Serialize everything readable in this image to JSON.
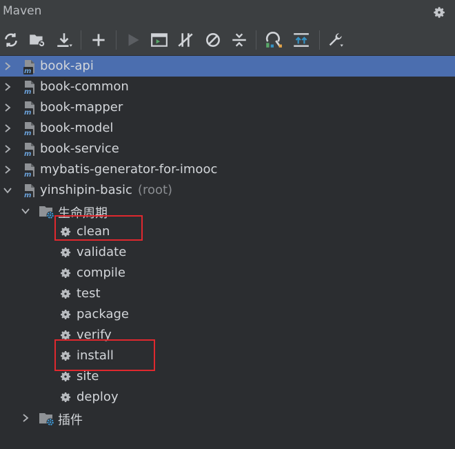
{
  "panel": {
    "title": "Maven"
  },
  "tree": {
    "projects": [
      {
        "label": "book-api"
      },
      {
        "label": "book-common"
      },
      {
        "label": "book-mapper"
      },
      {
        "label": "book-model"
      },
      {
        "label": "book-service"
      },
      {
        "label": "mybatis-generator-for-imooc"
      },
      {
        "label": "yinshipin-basic",
        "suffix": "(root)"
      }
    ],
    "lifecycle": {
      "label": "生命周期",
      "goals": [
        "clean",
        "validate",
        "compile",
        "test",
        "package",
        "verify",
        "install",
        "site",
        "deploy"
      ]
    },
    "plugins": {
      "label": "插件"
    }
  },
  "colors": {
    "background": "#2b2d30",
    "toolbar": "#3c3f41",
    "selection": "#4b6eaf",
    "highlight_box": "#e0282e"
  }
}
